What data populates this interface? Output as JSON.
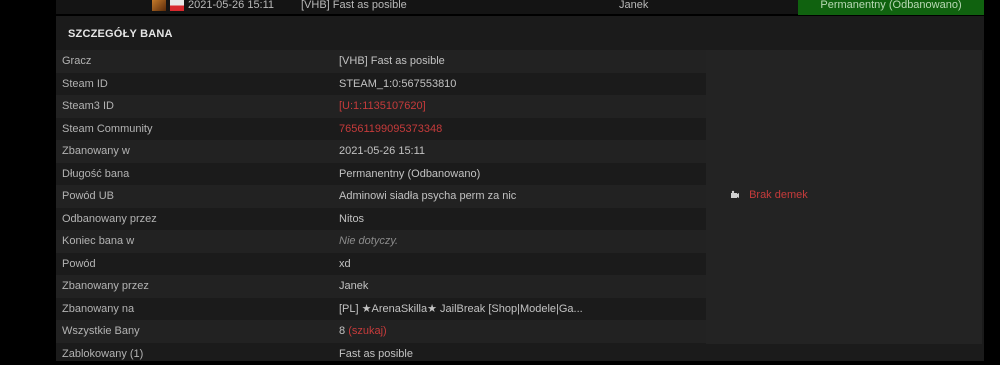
{
  "top_row": {
    "date": "2021-05-26 15:11",
    "name": "[VHB] Fast as posible",
    "admin": "Janek",
    "status": "Permanentny (Odbanowano)"
  },
  "panel": {
    "title": "SZCZEGÓŁY BANA"
  },
  "details": [
    {
      "label": "Gracz",
      "value": "[VHB] Fast as posible"
    },
    {
      "label": "Steam ID",
      "value": "STEAM_1:0:567553810"
    },
    {
      "label": "Steam3 ID",
      "value": "[U:1:1135107620]"
    },
    {
      "label": "Steam Community",
      "value": "76561199095373348"
    },
    {
      "label": "Zbanowany w",
      "value": "2021-05-26 15:11"
    },
    {
      "label": "Długość bana",
      "value": "Permanentny (Odbanowano)"
    },
    {
      "label": "Powód UB",
      "value": "Adminowi siadła psycha perm za nic"
    },
    {
      "label": "Odbanowany przez",
      "value": "Nitos"
    },
    {
      "label": "Koniec bana w",
      "value": "Nie dotyczy."
    },
    {
      "label": "Powód",
      "value": "xd"
    },
    {
      "label": "Zbanowany przez",
      "value": "Janek"
    },
    {
      "label": "Zbanowany na",
      "value": "[PL] ★ArenaSkilla★ JailBreak [Shop|Modele|Ga..."
    },
    {
      "label": "Wszystkie Bany",
      "value": "8",
      "link": "(szukaj)"
    },
    {
      "label": "Zablokowany (1)",
      "value": "Fast as posible"
    }
  ],
  "side": {
    "demo_label": "Brak demek",
    "demo_icon": "camera-icon"
  },
  "colors": {
    "link_red": "#c63b3b",
    "badge_green": "#10620f",
    "panel_bg": "#1b1b1b"
  }
}
